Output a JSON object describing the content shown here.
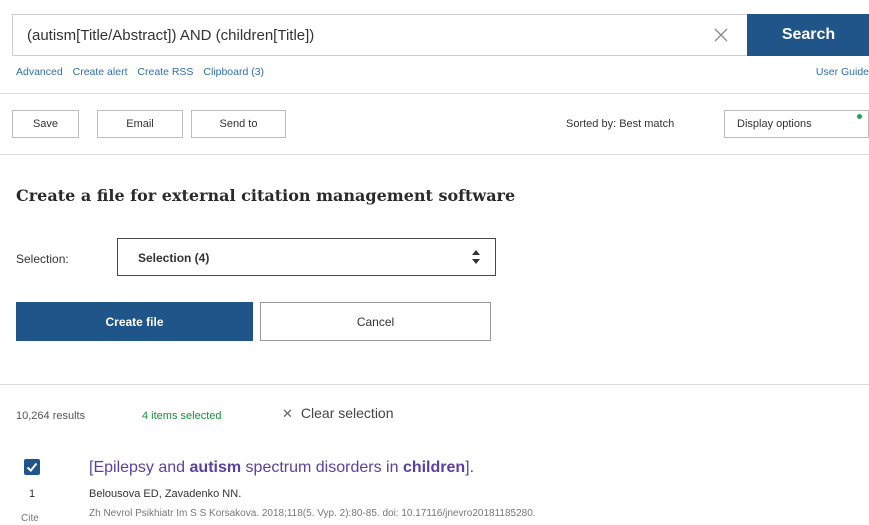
{
  "search": {
    "query": "(autism[Title/Abstract]) AND (children[Title])",
    "button_label": "Search"
  },
  "links": [
    "Advanced",
    "Create alert",
    "Create RSS",
    "Clipboard (3)"
  ],
  "user_guide": "User Guide",
  "toolbar": {
    "save": "Save",
    "email": "Email",
    "send_to": "Send to",
    "sorted_by": "Sorted by: Best match",
    "display_options": "Display options"
  },
  "citation": {
    "heading": "Create a file for external citation management software",
    "selection_label": "Selection:",
    "selection_value": "Selection (4)",
    "create_label": "Create file",
    "cancel_label": "Cancel"
  },
  "results": {
    "count": "10,264 results",
    "selected": "4 items selected",
    "clear": "Clear selection"
  },
  "article": {
    "index": "1",
    "cite": "Cite",
    "title_segments": [
      "[Epilepsy and ",
      "autism",
      " spectrum disorders in ",
      "children",
      "]."
    ],
    "authors": "Belousova ED, Zavadenko NN.",
    "journal": "Zh Nevrol Psikhiatr Im S S Korsakova. 2018;118(5. Vyp. 2):80-85. doi: 10.17116/jnevro20181185280."
  },
  "colors": {
    "primary": "#20558a",
    "link": "#2f6fb0",
    "title": "#5b3fa3",
    "selected": "#1b8f3f"
  }
}
